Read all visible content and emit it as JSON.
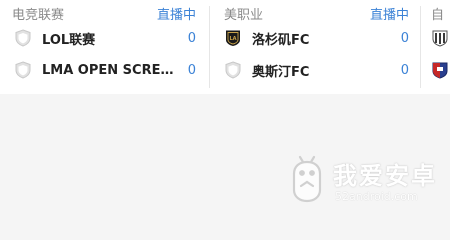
{
  "colors": {
    "accent": "#3b82d6",
    "league_text": "#8a8a8a",
    "team_text": "#222222",
    "page_bg": "#f5f5f5",
    "card_bg": "#ffffff"
  },
  "matches": [
    {
      "league": "电竞联赛",
      "status": "直播中",
      "teams": [
        {
          "name": "LOL联赛",
          "score": "0",
          "logo": "shield-icon"
        },
        {
          "name": "LMA OPEN SCREAM",
          "score": "0",
          "logo": "shield-icon"
        }
      ]
    },
    {
      "league": "美职业",
      "status": "直播中",
      "teams": [
        {
          "name": "洛杉矶FC",
          "score": "0",
          "logo": "lafc-crest-icon"
        },
        {
          "name": "奥斯汀FC",
          "score": "0",
          "logo": "shield-icon"
        }
      ]
    },
    {
      "league": "自",
      "status": "",
      "teams": [
        {
          "name": "",
          "score": "",
          "logo": "striped-crest-icon"
        },
        {
          "name": "",
          "score": "",
          "logo": "red-blue-crest-icon"
        }
      ]
    }
  ],
  "watermark": {
    "title": "我爱安卓",
    "url": "52android.com"
  }
}
